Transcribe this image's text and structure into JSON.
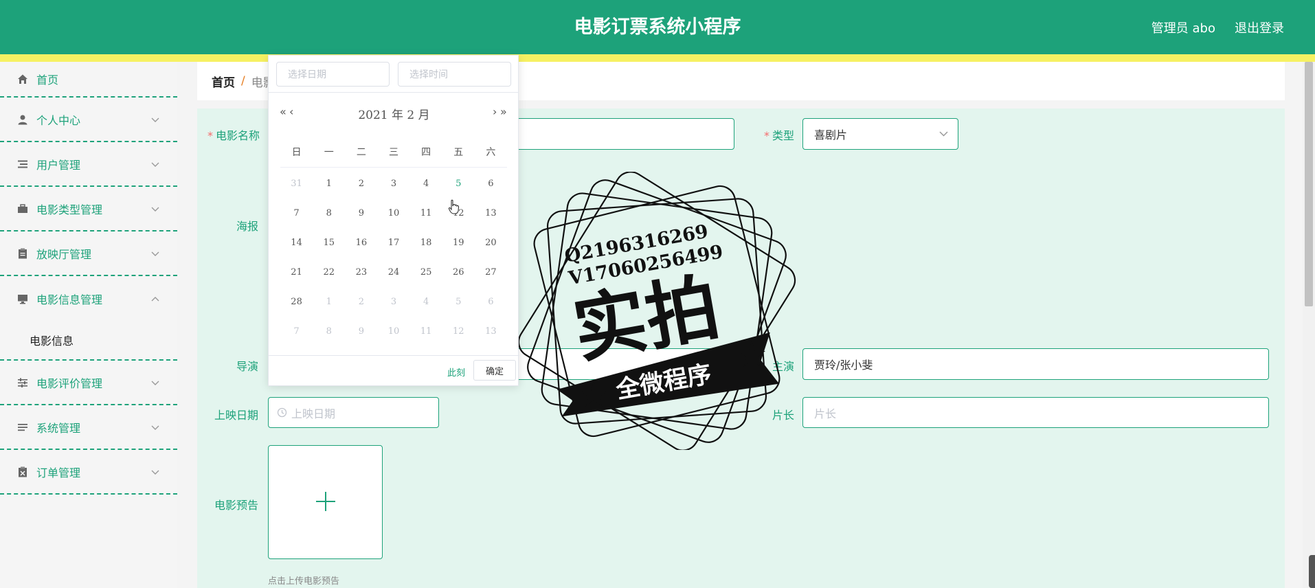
{
  "header": {
    "title": "电影订票系统小程序",
    "user_label": "管理员 abo",
    "logout_label": "退出登录"
  },
  "sidebar": {
    "items": [
      {
        "label": "首页",
        "icon": "home-icon",
        "expandable": false
      },
      {
        "label": "个人中心",
        "icon": "person-icon",
        "expandable": true
      },
      {
        "label": "用户管理",
        "icon": "list-icon",
        "expandable": true
      },
      {
        "label": "电影类型管理",
        "icon": "briefcase-icon",
        "expandable": true
      },
      {
        "label": "放映厅管理",
        "icon": "clipboard-icon",
        "expandable": true
      },
      {
        "label": "电影信息管理",
        "icon": "monitor-icon",
        "expandable": true,
        "open": true
      },
      {
        "label": "电影评价管理",
        "icon": "sliders-icon",
        "expandable": true
      },
      {
        "label": "系统管理",
        "icon": "settings-list-icon",
        "expandable": true
      },
      {
        "label": "订单管理",
        "icon": "order-icon",
        "expandable": true
      }
    ],
    "submenu": {
      "label": "电影信息"
    }
  },
  "breadcrumb": {
    "home": "首页",
    "separator": "/",
    "current": "电影"
  },
  "form": {
    "movie_name_label": "电影名称",
    "type_label": "类型",
    "type_value": "喜剧片",
    "poster_label": "海报",
    "director_label": "导演",
    "actor_label": "主演",
    "actor_value": "贾玲/张小斐",
    "release_label": "上映日期",
    "release_placeholder": "上映日期",
    "duration_label": "片长",
    "duration_placeholder": "片长",
    "trailer_label": "电影预告",
    "trailer_tip": "点击上传电影预告"
  },
  "datepicker": {
    "date_placeholder": "选择日期",
    "time_placeholder": "选择时间",
    "title": "2021 年  2 月",
    "prev_year": "«",
    "prev_month": "‹",
    "next_month": "›",
    "next_year": "»",
    "weekdays": [
      "日",
      "一",
      "二",
      "三",
      "四",
      "五",
      "六"
    ],
    "weeks": [
      [
        {
          "d": "31",
          "other": true
        },
        {
          "d": "1"
        },
        {
          "d": "2"
        },
        {
          "d": "3"
        },
        {
          "d": "4"
        },
        {
          "d": "5",
          "today": true
        },
        {
          "d": "6"
        }
      ],
      [
        {
          "d": "7"
        },
        {
          "d": "8"
        },
        {
          "d": "9"
        },
        {
          "d": "10"
        },
        {
          "d": "11"
        },
        {
          "d": "12"
        },
        {
          "d": "13"
        }
      ],
      [
        {
          "d": "14"
        },
        {
          "d": "15"
        },
        {
          "d": "16"
        },
        {
          "d": "17"
        },
        {
          "d": "18"
        },
        {
          "d": "19"
        },
        {
          "d": "20"
        }
      ],
      [
        {
          "d": "21"
        },
        {
          "d": "22"
        },
        {
          "d": "23"
        },
        {
          "d": "24"
        },
        {
          "d": "25"
        },
        {
          "d": "26"
        },
        {
          "d": "27"
        }
      ],
      [
        {
          "d": "28"
        },
        {
          "d": "1",
          "other": true
        },
        {
          "d": "2",
          "other": true
        },
        {
          "d": "3",
          "other": true
        },
        {
          "d": "4",
          "other": true
        },
        {
          "d": "5",
          "other": true
        },
        {
          "d": "6",
          "other": true
        }
      ],
      [
        {
          "d": "7",
          "other": true
        },
        {
          "d": "8",
          "other": true
        },
        {
          "d": "9",
          "other": true
        },
        {
          "d": "10",
          "other": true
        },
        {
          "d": "11",
          "other": true
        },
        {
          "d": "12",
          "other": true
        },
        {
          "d": "13",
          "other": true
        }
      ]
    ],
    "now_label": "此刻",
    "ok_label": "确定"
  },
  "watermark": {
    "line1": "Q2196316269",
    "line2": "V17060256499",
    "main": "实拍",
    "ribbon": "全微程序"
  },
  "colors": {
    "primary": "#1da27a",
    "strip": "#f6f163",
    "form_bg": "#e3f5ee",
    "required": "#f56c6c"
  }
}
